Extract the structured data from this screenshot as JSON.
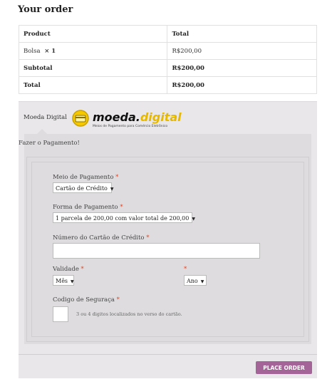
{
  "heading": "Your order",
  "table": {
    "headers": [
      "Product",
      "Total"
    ],
    "product_name": "Bolsa",
    "product_qty": "× 1",
    "product_total": "R$200,00",
    "subtotal_label": "Subtotal",
    "subtotal_value": "R$200,00",
    "total_label": "Total",
    "total_value": "R$200,00"
  },
  "payment": {
    "method_label": "Moeda Digital",
    "logo": {
      "text_main": "moeda.",
      "text_accent": "digital",
      "tagline": "Meios de Pagamento para Comércio Eletrônico"
    },
    "instruction": "Fazer o Pagamento!",
    "fields": {
      "meio_label": "Meio de Pagamento",
      "meio_value": "Cartão de Crédito",
      "forma_label": "Forma de Pagamento",
      "forma_value": "1 parcela de 200,00 com valor total de 200,00",
      "numero_label": "Número do Cartão de Crédito",
      "numero_value": "",
      "validade_label": "Validade",
      "mes_value": "Mês",
      "ano_value": "Ano",
      "codigo_label": "Codigo de Seguraça",
      "codigo_value": "",
      "codigo_help": "3 ou 4 digitos localizados no verso do cartão.",
      "required_mark": "*"
    }
  },
  "place_order": "PLACE ORDER",
  "colors": {
    "button": "#a46497",
    "required": "#e2401c",
    "panel": "#e9e7ea"
  }
}
